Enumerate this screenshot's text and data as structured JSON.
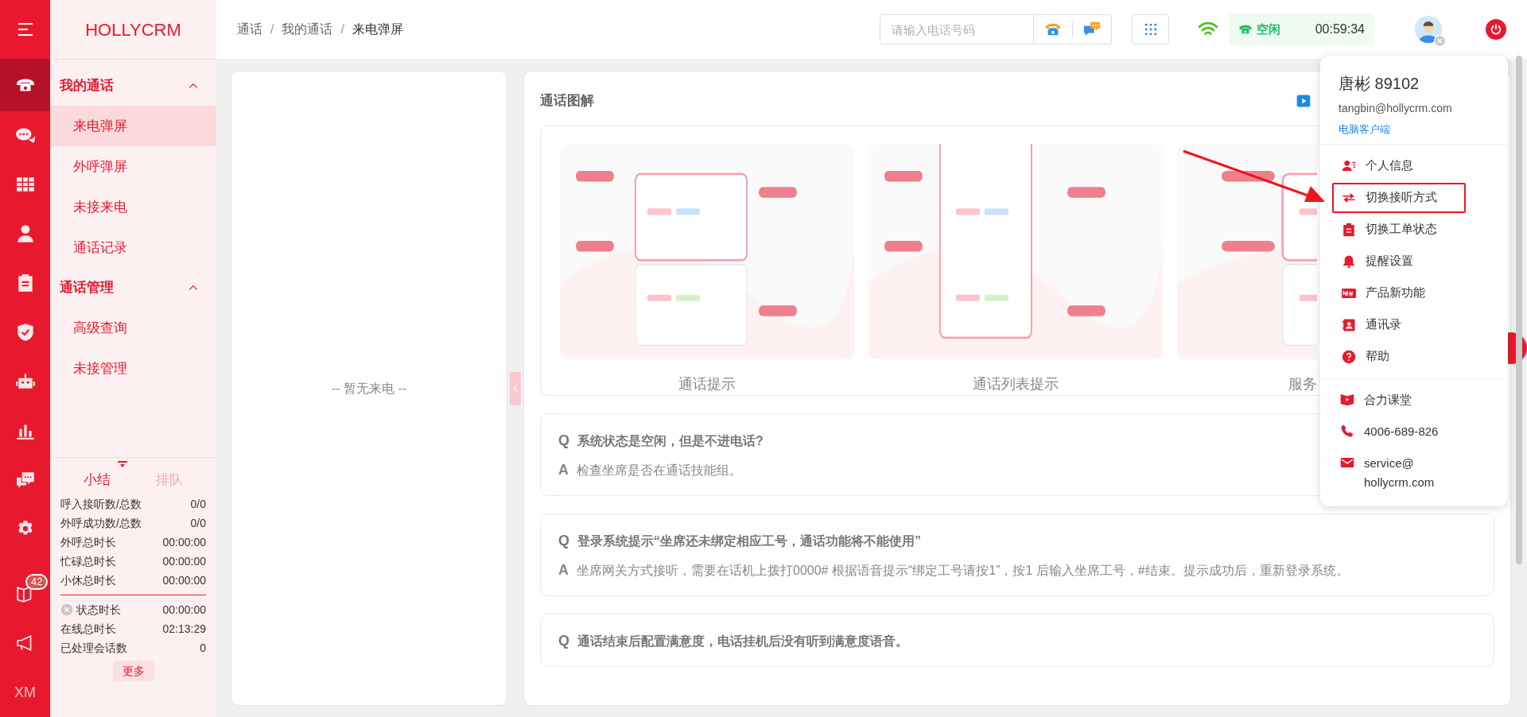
{
  "brand": "HOLLYCRM",
  "rail": [
    {
      "selected": true
    },
    {
      "selected": false
    },
    {
      "selected": false
    },
    {
      "selected": false
    },
    {
      "selected": false
    },
    {
      "selected": false
    },
    {
      "selected": false
    },
    {
      "selected": false
    },
    {
      "selected": false
    },
    {
      "selected": false
    },
    {
      "selected": false,
      "badge": "42"
    },
    {
      "selected": false
    },
    {
      "selected": false,
      "label": "XM"
    }
  ],
  "nav_groups": [
    {
      "title": "我的通话",
      "expanded": true,
      "items": [
        {
          "label": "来电弹屏",
          "selected": true
        },
        {
          "label": "外呼弹屏",
          "selected": false
        },
        {
          "label": "未接来电",
          "selected": false
        },
        {
          "label": "通话记录",
          "selected": false
        }
      ]
    },
    {
      "title": "通话管理",
      "expanded": true,
      "items": [
        {
          "label": "高级查询",
          "selected": false
        },
        {
          "label": "未接管理",
          "selected": false
        }
      ]
    }
  ],
  "summary_tabs": [
    {
      "label": "小结",
      "selected": true
    },
    {
      "label": "排队",
      "selected": false
    }
  ],
  "stats": [
    {
      "label": "呼入接听数/总数",
      "value": "0/0"
    },
    {
      "label": "外呼成功数/总数",
      "value": "0/0"
    },
    {
      "label": "外呼总时长",
      "value": "00:00:00"
    },
    {
      "label": "忙碌总时长",
      "value": "00:00:00"
    },
    {
      "label": "小休总时长",
      "value": "00:00:00"
    }
  ],
  "stats2": [
    {
      "label": "状态时长",
      "value": "00:00:00",
      "kind": "status"
    },
    {
      "label": "在线总时长",
      "value": "02:13:29",
      "kind": "plain"
    },
    {
      "label": "已处理会话数",
      "value": "0",
      "kind": "plain"
    }
  ],
  "more_button": "更多",
  "breadcrumb": [
    "通话",
    "我的通话",
    "来电弹屏"
  ],
  "breadcrumb_sep": "/",
  "phone_field": {
    "placeholder": "请输入电话号码"
  },
  "agent_status": {
    "label": "空闲",
    "timer": "00:59:34"
  },
  "empty_call": "-- 暂无来电 --",
  "diagram": {
    "title": "通话图解",
    "cards": [
      {
        "caption": "通话提示"
      },
      {
        "caption": "通话列表提示"
      },
      {
        "caption": "服务"
      }
    ]
  },
  "faq": [
    {
      "q_mark": "Q",
      "question": "系统状态是空闲，但是不进电话?",
      "a_mark": "A",
      "answer": "检查坐席是否在通话技能组。"
    },
    {
      "q_mark": "Q",
      "question": "登录系统提示“坐席还未绑定相应工号，通话功能将不能使用”",
      "a_mark": "A",
      "answer": "坐席网关方式接听，需要在话机上拨打0000# 根据语音提示“绑定工号请按1”，按1 后输入坐席工号，#结束。提示成功后，重新登录系统。"
    },
    {
      "q_mark": "Q",
      "question": "通话结束后配置满意度，电话挂机后没有听到满意度语音。"
    }
  ],
  "user_menu": {
    "name": "唐彬 89102",
    "email": "tangbin@hollycrm.com",
    "client_link": "电脑客户端",
    "items": [
      {
        "label": "个人信息",
        "highlighted": false
      },
      {
        "label": "切换接听方式",
        "highlighted": true
      },
      {
        "label": "切换工单状态",
        "highlighted": false
      },
      {
        "label": "提醒设置",
        "highlighted": false
      },
      {
        "label": "产品新功能",
        "highlighted": false
      },
      {
        "label": "通讯录",
        "highlighted": false
      },
      {
        "label": "帮助",
        "highlighted": false
      }
    ],
    "contacts": [
      {
        "label": "合力课堂"
      },
      {
        "label": "4006-689-826"
      },
      {
        "label": "service@\nhollycrm.com"
      }
    ]
  }
}
